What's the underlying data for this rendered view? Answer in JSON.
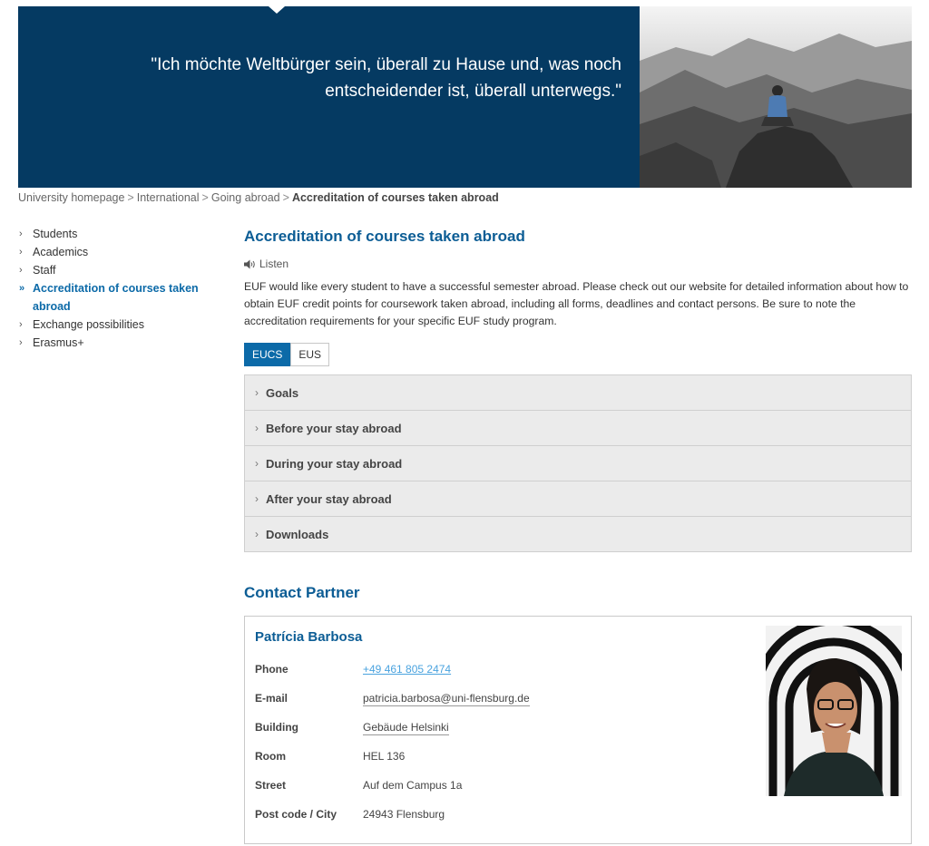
{
  "hero": {
    "quote_line1": "\"Ich möchte Weltbürger sein, überall zu Hause und, was noch",
    "quote_line2": "entscheidender ist, überall unterwegs.\""
  },
  "breadcrumb": {
    "items": [
      "University homepage",
      "International",
      "Going abroad"
    ],
    "current": "Accreditation of courses taken abroad",
    "separator": ">"
  },
  "sidebar": {
    "items": [
      {
        "label": "Students"
      },
      {
        "label": "Academics"
      },
      {
        "label": "Staff"
      },
      {
        "label": "Accreditation of courses taken abroad",
        "active": true
      },
      {
        "label": "Exchange possibilities"
      },
      {
        "label": "Erasmus+"
      }
    ]
  },
  "main": {
    "title": "Accreditation of courses taken abroad",
    "listen_label": "Listen",
    "intro": "EUF would like every student to have a successful semester abroad. Please check out our website for detailed information about how to obtain EUF credit points for coursework taken abroad, including all forms, deadlines and contact persons. Be sure to note the accreditation requirements for your specific EUF study program.",
    "tabs": [
      {
        "label": "EUCS",
        "active": true
      },
      {
        "label": "EUS",
        "active": false
      }
    ],
    "accordion": [
      {
        "label": "Goals"
      },
      {
        "label": "Before your stay abroad"
      },
      {
        "label": "During your stay abroad"
      },
      {
        "label": "After your stay abroad"
      },
      {
        "label": "Downloads"
      }
    ]
  },
  "contact": {
    "heading": "Contact Partner",
    "name": "Patrícia Barbosa",
    "rows": [
      {
        "label": "Phone",
        "value": "+49 461 805 2474"
      },
      {
        "label": "E-mail",
        "value": "patricia.barbosa@uni-flensburg.de"
      },
      {
        "label": "Building",
        "value": "Gebäude Helsinki"
      },
      {
        "label": "Room",
        "value": "HEL 136"
      },
      {
        "label": "Street",
        "value": "Auf dem Campus 1a"
      },
      {
        "label": "Post code / City",
        "value": "24943 Flensburg"
      }
    ]
  },
  "icons": {
    "chevron": "›",
    "chevron_active": "»",
    "speaker": "speaker-icon"
  },
  "colors": {
    "header_bg": "#053a62",
    "accent": "#0c6aa8",
    "heading": "#0c5d95",
    "accordion_bg": "#ebebeb"
  }
}
